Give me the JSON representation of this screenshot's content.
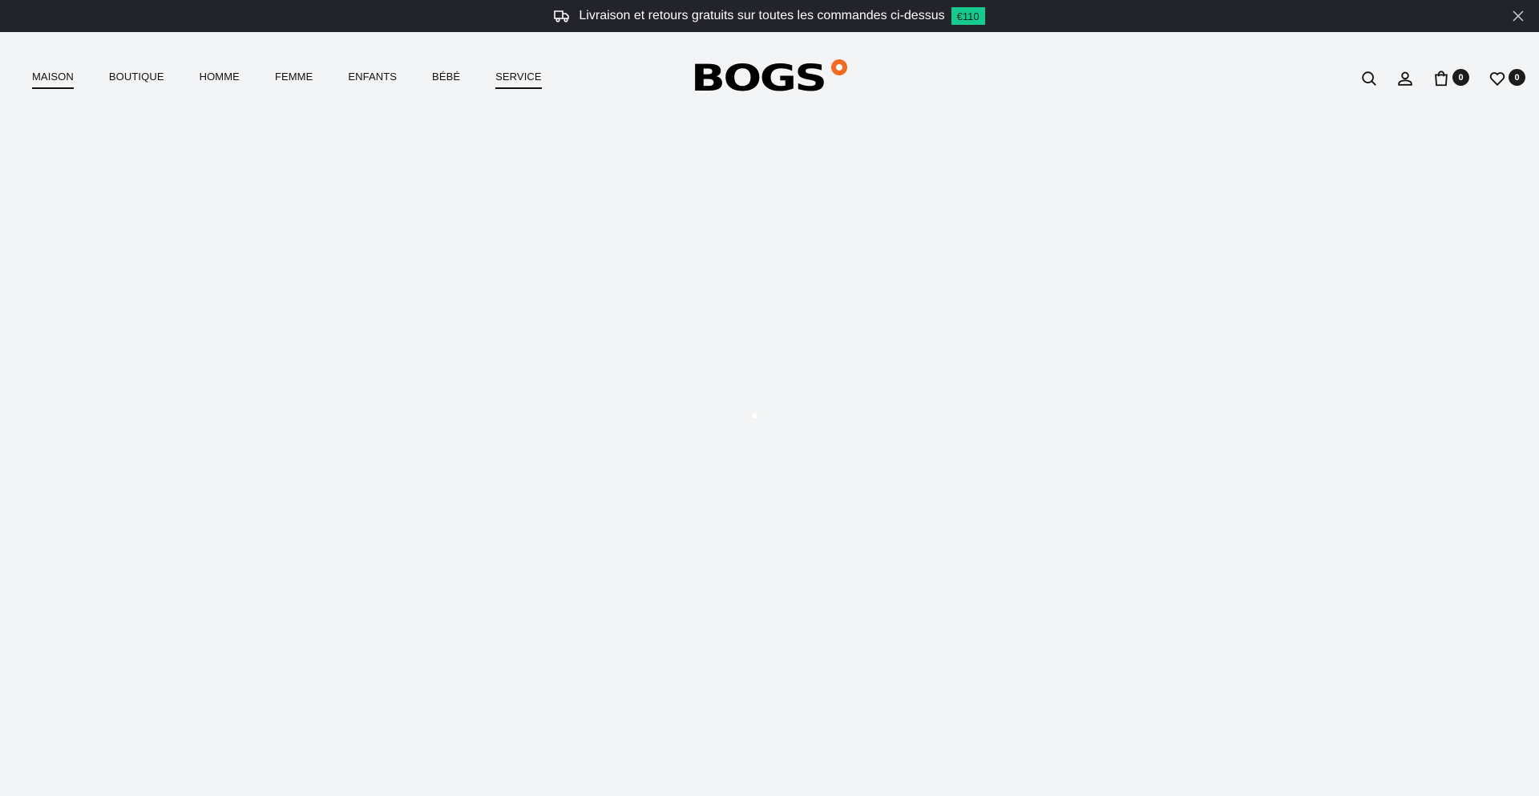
{
  "announcement": {
    "text": "Livraison et retours gratuits sur toutes les commandes ci-dessus",
    "badge": "€110",
    "icon": "truck-icon",
    "badge_color": "#16c98d",
    "background": "#22232b"
  },
  "nav": {
    "items": [
      {
        "label": "MAISON",
        "active": true
      },
      {
        "label": "BOUTIQUE",
        "active": false
      },
      {
        "label": "HOMME",
        "active": false
      },
      {
        "label": "FEMME",
        "active": false
      },
      {
        "label": "ENFANTS",
        "active": false
      },
      {
        "label": "BÉBÉ",
        "active": false
      },
      {
        "label": "SERVICE",
        "active": true
      }
    ]
  },
  "logo": {
    "text": "BOGS",
    "accent_color": "#f26b21"
  },
  "header_icons": {
    "search": "search-icon",
    "account": "user-icon",
    "cart": "shopping-bag-icon",
    "cart_count": "0",
    "wishlist": "heart-icon",
    "wishlist_count": "0"
  }
}
